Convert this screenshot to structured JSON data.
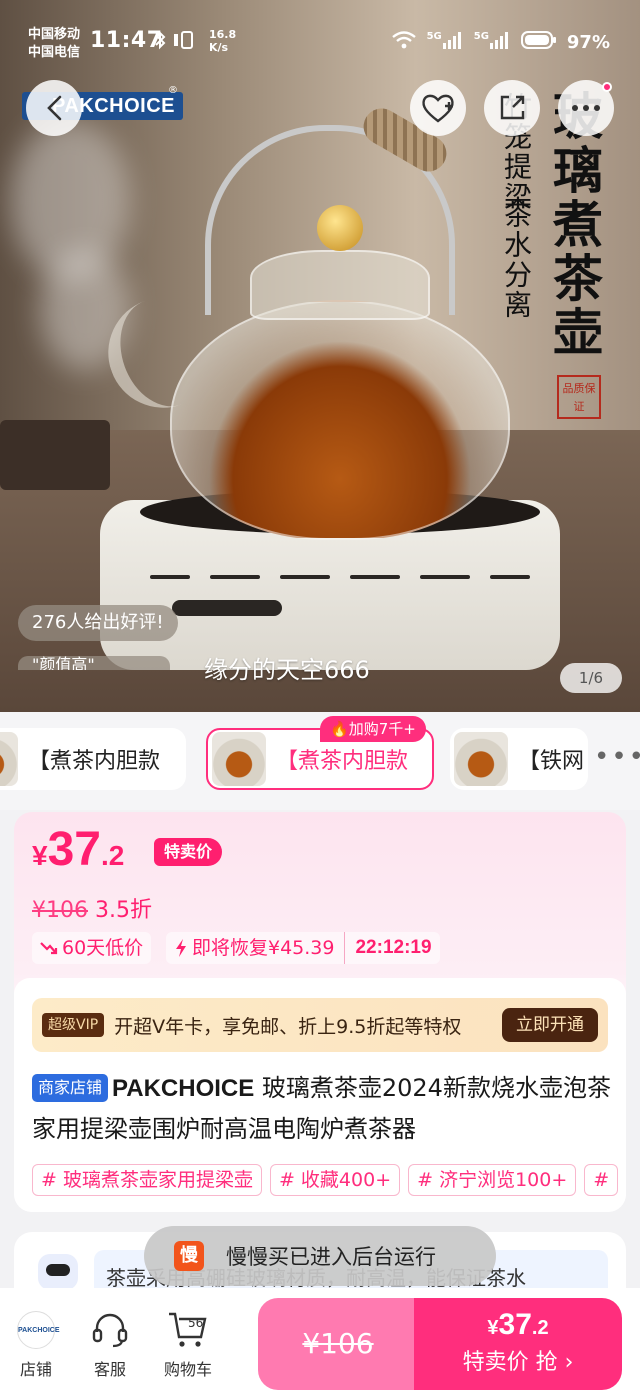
{
  "status_bar": {
    "carrier1": "中国移动",
    "carrier2": "中国电信",
    "time": "11:47",
    "speed_value": "16.8",
    "speed_unit": "K/s",
    "net1": "5G",
    "net2": "5G",
    "battery": "97%"
  },
  "hero": {
    "brand_logo": "PAKCHOICE",
    "brand_logo_mark": "®",
    "vertical_title": "玻璃煮茶壶",
    "vertical_sub1": "竹笼提梁",
    "vertical_sub2": "茶水分离",
    "seal_text": "品质保证",
    "review_bubble": "276人给出好评!",
    "review_bubble_next": "\"颜值高\"",
    "danmu": "缘分的天空666",
    "image_counter": "1/6"
  },
  "sku": {
    "items": [
      {
        "label": "【煮茶内胆款"
      },
      {
        "label": "【煮茶内胆款"
      },
      {
        "label": "【铁网"
      }
    ],
    "selected_tag": "加购7千+",
    "more": "•••"
  },
  "price": {
    "currency": "¥",
    "integer": "37",
    "decimal": ".2",
    "badge": "特卖价",
    "original": "¥106",
    "discount": "3.5折",
    "chip1": "60天低价",
    "chip2": "即将恢复¥45.39",
    "countdown": "22:12:19"
  },
  "vip": {
    "tag": "超级VIP",
    "text": "开超V年卡，享免邮、折上9.5折起等特权",
    "button": "立即开通"
  },
  "product": {
    "shop_tag": "商家店铺",
    "brand": "PAKCHOICE",
    "title": " 玻璃煮茶壶2024新款烧水壶泡茶家用提梁壶围炉耐高温电陶炉煮茶器",
    "tags": [
      "# 玻璃煮茶壶家用提梁壶",
      "# 收藏400+",
      "# 济宁浏览100+",
      "#"
    ]
  },
  "review": {
    "text": "茶壶采用高硼硅玻璃材质，耐高温，能保证茶水"
  },
  "toast": {
    "icon": "慢",
    "text": "慢慢买已进入后台运行"
  },
  "bottom_bar": {
    "shop_logo": "PAKCHOICE",
    "shop": "店铺",
    "service": "客服",
    "cart": "购物车",
    "cart_count": "56",
    "orig_price": "¥106",
    "buy_currency": "¥",
    "buy_integer": "37",
    "buy_decimal": ".2",
    "buy_label": "特卖价 抢"
  },
  "colors": {
    "accent": "#ff2e7d",
    "brand_blue": "#1d4f91"
  }
}
